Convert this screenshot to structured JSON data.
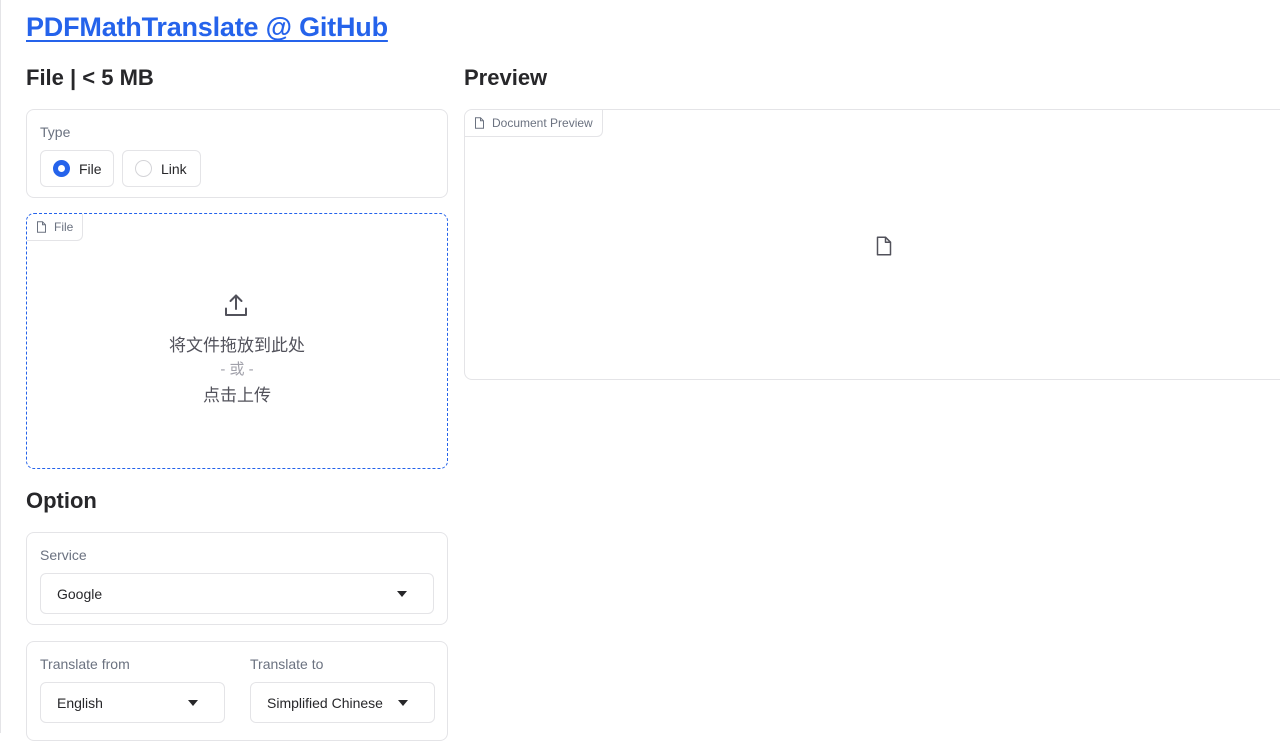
{
  "header": {
    "title_link": "PDFMathTranslate @ GitHub"
  },
  "file_section": {
    "heading": "File | < 5 MB",
    "type": {
      "label": "Type",
      "options": [
        {
          "label": "File",
          "selected": true
        },
        {
          "label": "Link",
          "selected": false
        }
      ]
    },
    "dropzone": {
      "tag": "File",
      "main_text": "将文件拖放到此处",
      "or_text": "- 或 -",
      "click_text": "点击上传"
    }
  },
  "preview_section": {
    "heading": "Preview",
    "tag": "Document Preview"
  },
  "option_section": {
    "heading": "Option",
    "service": {
      "label": "Service",
      "selected": "Google"
    },
    "translate_from": {
      "label": "Translate from",
      "selected": "English"
    },
    "translate_to": {
      "label": "Translate to",
      "selected": "Simplified Chinese"
    }
  },
  "colors": {
    "accent": "#2563eb",
    "border": "#e4e4e7",
    "muted_text": "#6b7280"
  },
  "icons": {
    "upload": "upload-icon",
    "document": "file-icon",
    "caret": "chevron-down-icon"
  }
}
